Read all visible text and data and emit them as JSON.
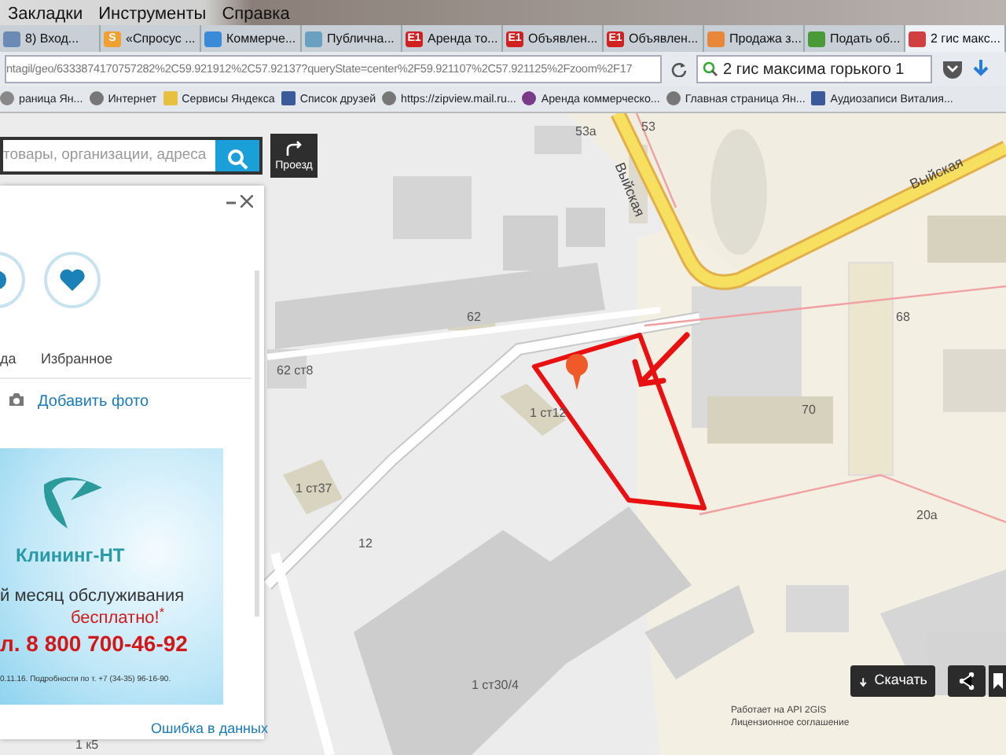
{
  "menu_bar": [
    "Закладки",
    "Инструменты",
    "Справка"
  ],
  "tabs": [
    {
      "label": "8) Вход...",
      "selected": false
    },
    {
      "label": "«Спросус ...",
      "favicon_text": "S",
      "selected": false
    },
    {
      "label": "Коммерче...",
      "selected": false
    },
    {
      "label": "Публична...",
      "selected": false
    },
    {
      "label": "Аренда то...",
      "favicon_text": "E1",
      "selected": false
    },
    {
      "label": "Объявлен...",
      "favicon_text": "E1",
      "selected": false
    },
    {
      "label": "Объявлен...",
      "favicon_text": "E1",
      "selected": false
    },
    {
      "label": "Продажа з...",
      "selected": false
    },
    {
      "label": "Подать об...",
      "selected": false
    },
    {
      "label": "2 гис макс...",
      "selected": true
    }
  ],
  "address_bar": {
    "url": "ntagil/geo/6333874170757282%2C59.921912%2C57.92137?queryState=center%2F59.921107%2C57.921125%2Fzoom%2F17",
    "search": "2 гис максима горького 1"
  },
  "bookmarks": [
    "раница Ян...",
    "Интернет",
    "Сервисы Яндекса",
    "Список друзей",
    "https://zipview.mail.ru...",
    "Аренда коммерческо...",
    "Главная страница Ян...",
    "Аудиозаписи Виталия..."
  ],
  "map": {
    "search": {
      "placeholder": "товары, организации, адреса"
    },
    "route_button": "Проезд",
    "panel": {
      "actions": [
        "да",
        "Избранное"
      ],
      "add_photo": "Добавить фото",
      "ad": {
        "brand": "Клининг-НТ",
        "line_1": "й месяц обслуживания",
        "line_2": "бесплатно!$^{*}$",
        "phone": "л. 8 800 700-46-92",
        "footnote": "0.11.16. Подробности по т. +7 (34-35) 96-16-90."
      },
      "report_link": "Ошибка в данных"
    },
    "labels": [
      "53а",
      "53",
      "62",
      "62 ст8",
      "68",
      "70",
      "1 ст12",
      "1 ст37",
      "12",
      "1 ст30/4",
      "20а",
      "1 к5"
    ],
    "streets": [
      "Выйская",
      "Выйская"
    ],
    "attribution": [
      "Работает на API 2GIS",
      "Лицензионное соглашение"
    ],
    "download_button": "Скачать"
  }
}
